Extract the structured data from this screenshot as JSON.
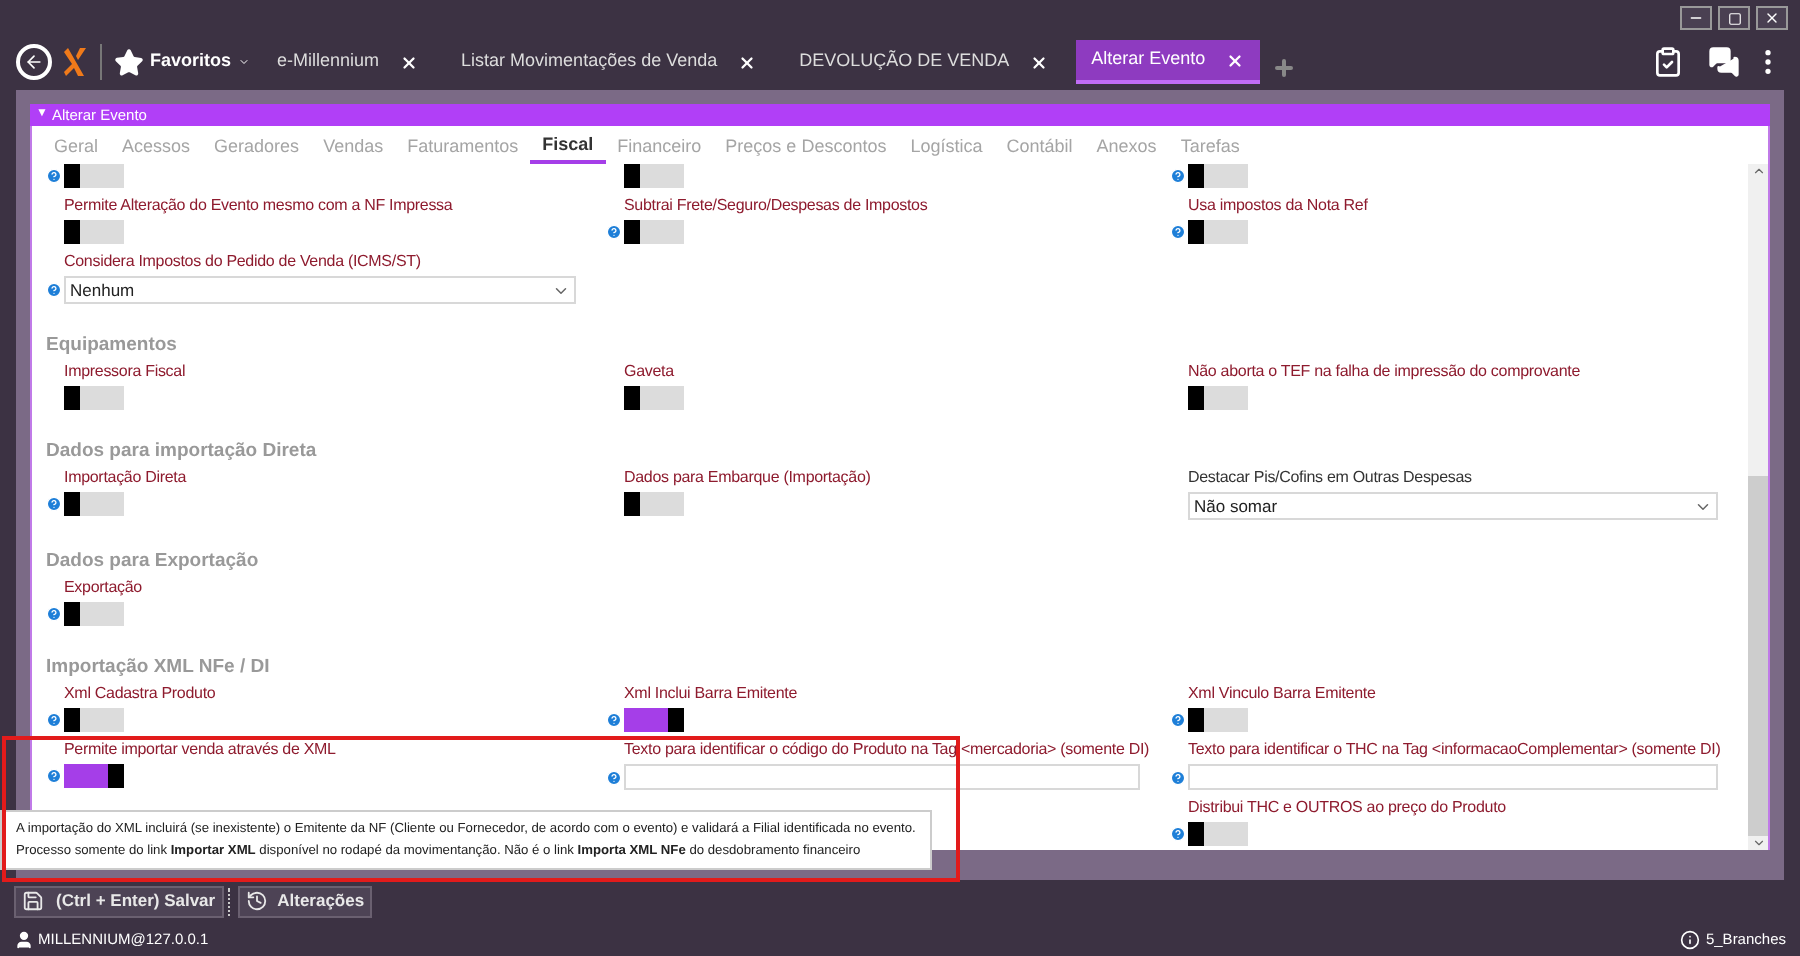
{
  "top_tabs": [
    {
      "label": "e-Millennium",
      "selected": false
    },
    {
      "label": "Listar Movimentações de Venda",
      "selected": false
    },
    {
      "label": "DEVOLUÇÃO DE VENDA",
      "selected": false
    },
    {
      "label": "Alterar Evento",
      "selected": true
    }
  ],
  "favorites": "Favoritos",
  "panel": {
    "title": "Alterar Evento",
    "collapse_glyph": "▼"
  },
  "form_tabs": [
    {
      "label": "Geral",
      "selected": false
    },
    {
      "label": "Acessos",
      "selected": false
    },
    {
      "label": "Geradores",
      "selected": false
    },
    {
      "label": "Vendas",
      "selected": false
    },
    {
      "label": "Faturamentos",
      "selected": false
    },
    {
      "label": "Fiscal",
      "selected": true
    },
    {
      "label": "Financeiro",
      "selected": false
    },
    {
      "label": "Preços e Descontos",
      "selected": false
    },
    {
      "label": "Logística",
      "selected": false
    },
    {
      "label": "Contábil",
      "selected": false
    },
    {
      "label": "Anexos",
      "selected": false
    },
    {
      "label": "Tarefas",
      "selected": false
    }
  ],
  "sections": [
    {
      "rows": [
        [
          {
            "kind": "toggle",
            "help": true,
            "on": false
          },
          {
            "kind": "toggle",
            "help": false,
            "on": false
          },
          {
            "kind": "toggle",
            "help": true,
            "on": false
          }
        ],
        [
          {
            "kind": "toggle",
            "label": "Permite Alteração do Evento mesmo com a NF Impressa",
            "help": false,
            "on": false
          },
          {
            "kind": "toggle",
            "label": "Subtrai Frete/Seguro/Despesas de Impostos",
            "help": true,
            "on": false
          },
          {
            "kind": "toggle",
            "label": "Usa impostos da Nota Ref",
            "help": true,
            "on": false
          }
        ],
        [
          {
            "kind": "select",
            "label": "Considera Impostos do Pedido de Venda (ICMS/ST)",
            "help": true,
            "value": "Nenhum"
          }
        ]
      ]
    },
    {
      "title": "Equipamentos",
      "rows": [
        [
          {
            "kind": "toggle",
            "label": "Impressora Fiscal",
            "help": false,
            "on": false
          },
          {
            "kind": "toggle",
            "label": "Gaveta",
            "help": false,
            "on": false
          },
          {
            "kind": "toggle",
            "label": "Não aborta o TEF na falha de impressão do comprovante",
            "help": false,
            "on": false
          }
        ]
      ]
    },
    {
      "title": "Dados para importação Direta",
      "rows": [
        [
          {
            "kind": "toggle",
            "label": "Importação Direta",
            "help": true,
            "on": false
          },
          {
            "kind": "toggle",
            "label": "Dados para Embarque (Importação)",
            "help": false,
            "on": false
          },
          {
            "kind": "select",
            "label": "Destacar Pis/Cofins em Outras Despesas",
            "help": false,
            "value": "Não somar"
          }
        ]
      ]
    },
    {
      "title": "Dados para Exportação",
      "rows": [
        [
          {
            "kind": "toggle",
            "label": "Exportação",
            "help": true,
            "on": false
          }
        ]
      ]
    },
    {
      "title": "Importação XML NFe / DI",
      "rows": [
        [
          {
            "kind": "toggle",
            "label": "Xml Cadastra Produto",
            "help": true,
            "on": false
          },
          {
            "kind": "toggle",
            "label": "Xml Inclui Barra Emitente",
            "help": true,
            "on": true
          },
          {
            "kind": "toggle",
            "label": "Xml Vinculo Barra Emitente",
            "help": true,
            "on": false
          }
        ],
        [
          {
            "kind": "toggle",
            "label": "Permite importar venda através de XML",
            "help": true,
            "on": true
          },
          {
            "kind": "text",
            "label": "Texto para identificar o código do Produto na Tag <mercadoria> (somente DI)",
            "help": true
          },
          {
            "kind": "text",
            "label": "Texto para identificar o THC na Tag <informacaoComplementar> (somente DI)",
            "help": true
          }
        ],
        [
          {
            "kind": "hidden"
          },
          {
            "kind": "hidden"
          },
          {
            "kind": "toggle",
            "label": "Distribui THC e OUTROS ao preço do Produto",
            "help": true,
            "on": false
          }
        ]
      ]
    }
  ],
  "tooltip": [
    "A importação do XML incluirá (se inexistente) o Emitente da NF (Cliente ou Fornecedor, de acordo com o evento) e validará a Filial identificada no evento.",
    "Processo somente do link **Importar XML** disponível no rodapé da movimentanção. Não é o link **Importa XML NFe** do desdobramento financeiro"
  ],
  "buttons": [
    "(Ctrl + Enter) Salvar",
    "Alterações"
  ],
  "status_bar": {
    "user": "MILLENNIUM@127.0.0.1",
    "branch": "5_Branches"
  }
}
